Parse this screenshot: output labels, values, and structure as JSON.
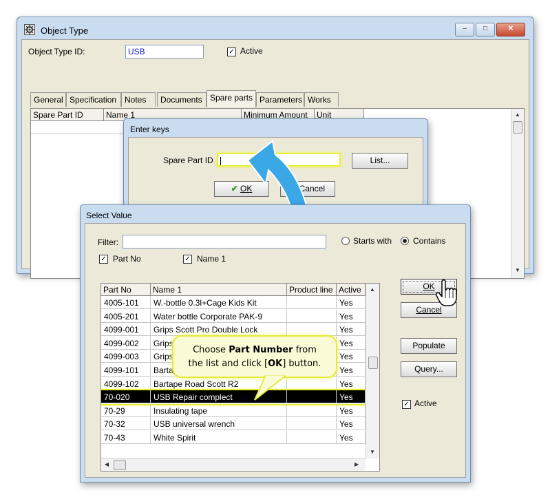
{
  "main_window": {
    "title": "Object Type",
    "controls": {
      "minimize": "–",
      "maximize": "□",
      "close": "✕"
    },
    "type_id_label": "Object Type ID:",
    "type_id_value": "USB",
    "active_label": "Active",
    "active_checked": true,
    "tabs": [
      {
        "label": "General"
      },
      {
        "label": "Specification"
      },
      {
        "label": "Notes"
      },
      {
        "label": "Documents"
      },
      {
        "label": "Spare parts",
        "active": true
      },
      {
        "label": "Parameters"
      },
      {
        "label": "Works"
      }
    ],
    "grid_headers": [
      "Spare Part ID",
      "Name 1",
      "Minimum Amount",
      "Unit"
    ]
  },
  "enter_keys": {
    "title": "Enter keys",
    "spare_part_label": "Spare Part ID",
    "spare_part_value": "",
    "list_button": "List...",
    "ok_button": "OK",
    "cancel_button": "Cancel"
  },
  "select_value": {
    "title": "Select Value",
    "filter_label": "Filter:",
    "filter_value": "",
    "starts_with_label": "Starts with",
    "contains_label": "Contains",
    "match_mode": "Contains",
    "part_no_check_label": "Part No",
    "name1_check_label": "Name 1",
    "columns": [
      "Part No",
      "Name 1",
      "Product line",
      "Active"
    ],
    "rows": [
      {
        "part_no": "4005-101",
        "name": "W.-bottle 0.3l+Cage Kids Kit",
        "product_line": "",
        "active": "Yes"
      },
      {
        "part_no": "4005-201",
        "name": "Water bottle Corporate PAK-9",
        "product_line": "",
        "active": "Yes"
      },
      {
        "part_no": "4099-001",
        "name": "Grips Scott Pro Double Lock",
        "product_line": "",
        "active": "Yes"
      },
      {
        "part_no": "4099-002",
        "name": "Grips",
        "product_line": "",
        "active": "Yes"
      },
      {
        "part_no": "4099-003",
        "name": "Grips",
        "product_line": "",
        "active": "Yes"
      },
      {
        "part_no": "4099-101",
        "name": "Bartap",
        "product_line": "",
        "active": "Yes"
      },
      {
        "part_no": "4099-102",
        "name": "Bartape Road Scott R2",
        "product_line": "",
        "active": "Yes"
      },
      {
        "part_no": "70-020",
        "name": "USB Repair complect",
        "product_line": "",
        "active": "Yes",
        "selected": true
      },
      {
        "part_no": "70-29",
        "name": "Insulating tape",
        "product_line": "",
        "active": "Yes"
      },
      {
        "part_no": "70-32",
        "name": "USB universal wrench",
        "product_line": "",
        "active": "Yes"
      },
      {
        "part_no": "70-43",
        "name": "White Spirit",
        "product_line": "",
        "active": "Yes"
      }
    ],
    "ok_button": "OK",
    "cancel_button": "Cancel",
    "populate_button": "Populate",
    "query_button": "Query...",
    "active_label": "Active",
    "active_checked": true
  },
  "callout": {
    "line1_pre": "Choose ",
    "line1_bold": "Part Number",
    "line1_post": " from",
    "line2_pre": "the list and click [",
    "line2_bold": "OK",
    "line2_post": "] button."
  },
  "colors": {
    "highlight": "#e8ef35",
    "arrow": "#3aa8e6",
    "window_frame": "#c9dcf0",
    "client_bg": "#ece9d8"
  }
}
